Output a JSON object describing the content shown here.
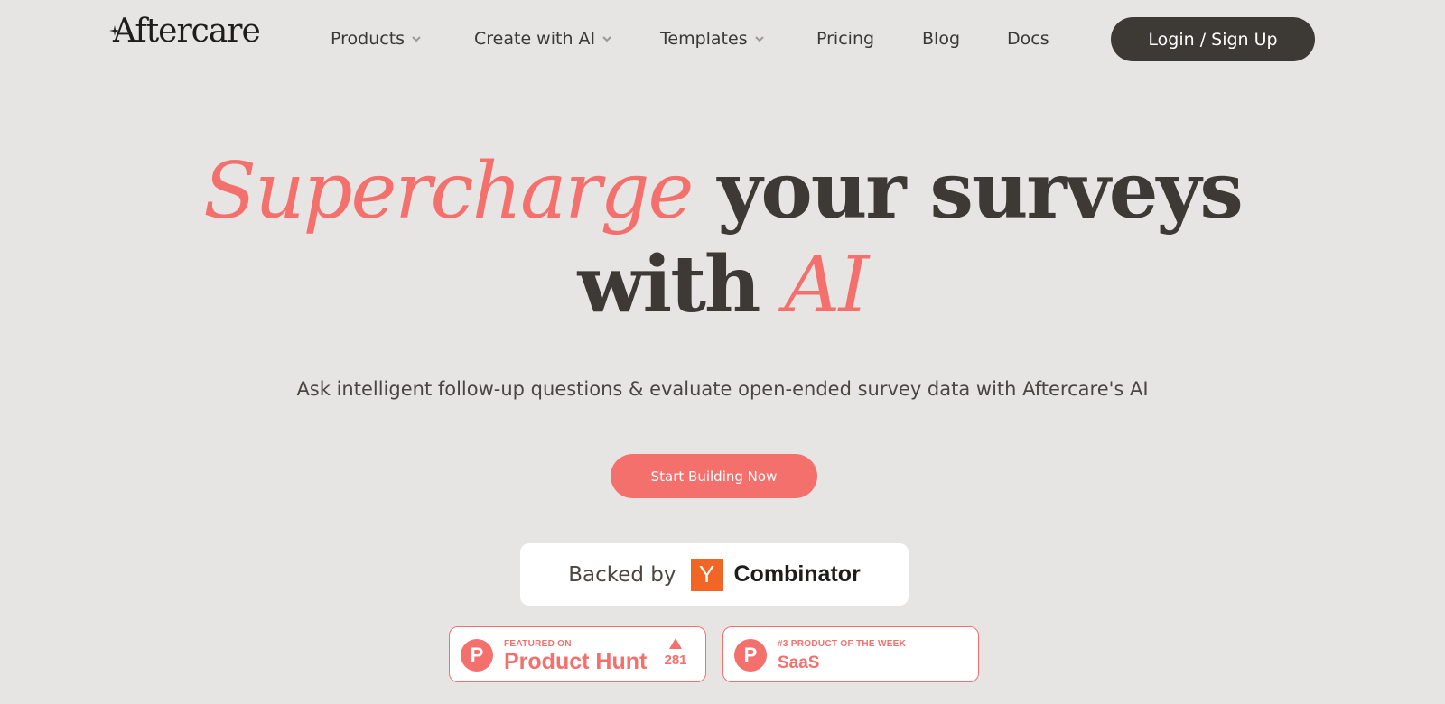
{
  "header": {
    "logo": "Aftercare",
    "nav": [
      {
        "label": "Products",
        "has_dropdown": true,
        "icon": "chevron-down-icon"
      },
      {
        "label": "Create with AI",
        "has_dropdown": true,
        "icon": "chevron-down-icon"
      },
      {
        "label": "Templates",
        "has_dropdown": true,
        "icon": "chevron-down-icon"
      },
      {
        "label": "Pricing",
        "has_dropdown": false
      },
      {
        "label": "Blog",
        "has_dropdown": false
      },
      {
        "label": "Docs",
        "has_dropdown": false
      }
    ],
    "login_label": "Login / Sign Up"
  },
  "hero": {
    "title_accent_1": "Supercharge",
    "title_rest_1": " your surveys",
    "title_rest_2": "with ",
    "title_accent_2": "AI",
    "subtitle": "Ask intelligent follow-up questions & evaluate open-ended survey data with Aftercare's AI",
    "cta_label": "Start Building Now"
  },
  "backed": {
    "label": "Backed by",
    "yc_letter": "Y",
    "yc_name": "Combinator"
  },
  "badges": [
    {
      "logo_letter": "P",
      "small": "FEATURED ON",
      "big": "Product Hunt",
      "votes": "281"
    },
    {
      "logo_letter": "P",
      "small": "#3 PRODUCT OF THE WEEK",
      "big": "SaaS"
    }
  ],
  "colors": {
    "background": "#e7e5e3",
    "accent": "#f4706c",
    "dark": "#3d3a36",
    "yc_orange": "#f26625"
  }
}
